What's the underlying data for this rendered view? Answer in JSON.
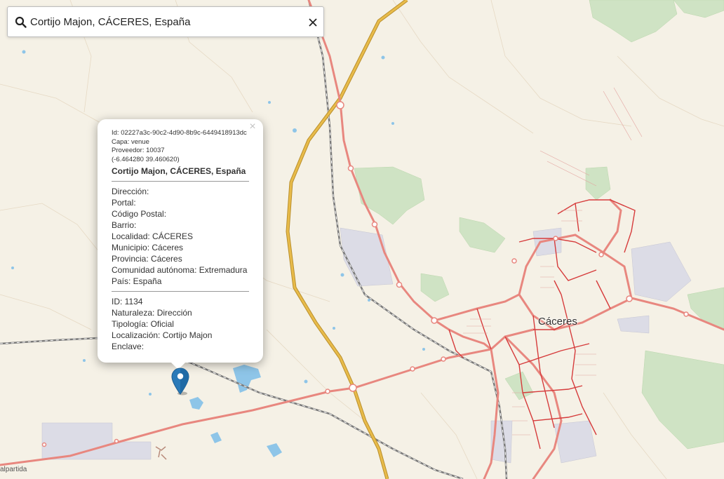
{
  "search": {
    "value": "Cortijo Majon, CÁCERES, España",
    "search_icon": "search-icon",
    "clear_icon": "close-icon"
  },
  "popup": {
    "meta": [
      "Id: 02227a3c-90c2-4d90-8b9c-6449418913dc",
      "Capa: venue",
      "Proveedor: 10037",
      "(-6.464280 39.460620)"
    ],
    "title": "Cortijo Majon, CÁCERES, España",
    "address_fields": [
      "Dirección:",
      "Portal:",
      "Código Postal:",
      "Barrio:",
      "Localidad: CÁCERES",
      "Municipio: Cáceres",
      "Provincia: Cáceres",
      "Comunidad autónoma: Extremadura",
      "País: España"
    ],
    "detail_fields": [
      "ID: 1134",
      "Naturaleza: Dirección",
      "Tipología: Oficial",
      "Localización: Cortijo Majon",
      "Enclave:"
    ],
    "close_symbol": "×"
  },
  "map": {
    "city_label": "Cáceres",
    "town_label": "alpartida",
    "marker_icon": "map-pin-icon",
    "colors": {
      "land": "#f5f1e6",
      "main_road": "#e8877f",
      "motorway": "#d4a437",
      "city_street": "#d63b3b",
      "rail": "#7a7a7a",
      "water": "#8ec5e8",
      "forest": "#cfe3c4",
      "industrial": "#dcdce6",
      "marker": "#2a7ab8"
    }
  }
}
